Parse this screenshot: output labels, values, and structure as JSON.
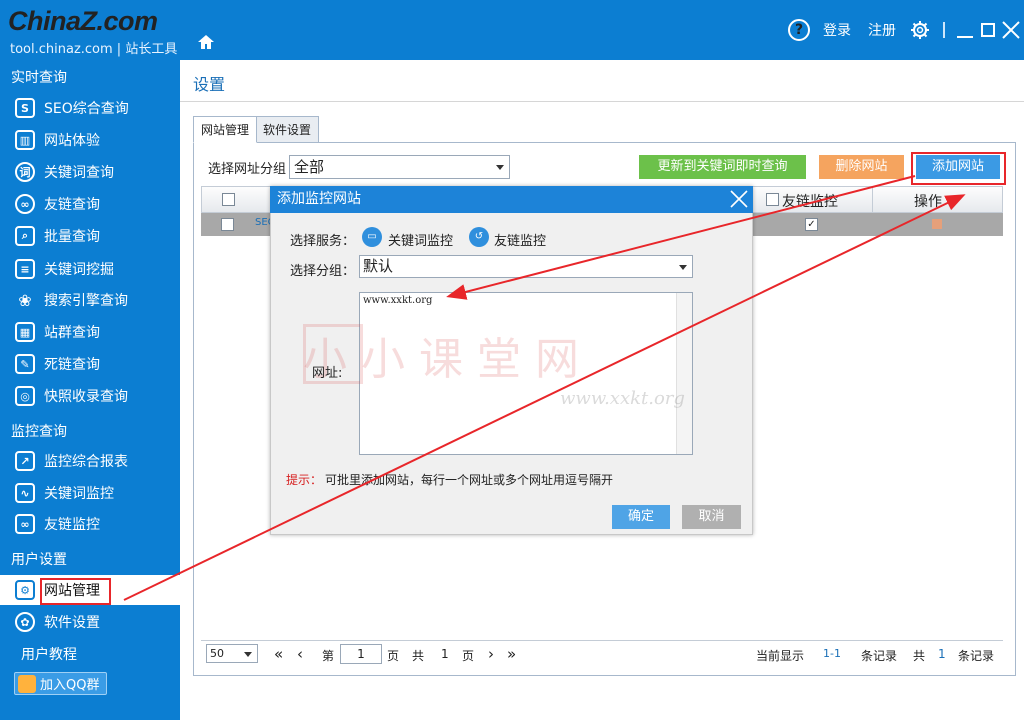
{
  "app": {
    "logo_text": "ChinaZ.com",
    "logo_sub": "tool.chinaz.com | 站长工具",
    "login": "登录",
    "register": "注册",
    "help_symbol": "?"
  },
  "sidebar": {
    "sections": [
      {
        "label": "实时查询"
      },
      {
        "label": "监控查询"
      },
      {
        "label": "用户设置"
      }
    ],
    "items": [
      {
        "label": "SEO综合查询",
        "icon": "magnifier-doc-icon"
      },
      {
        "label": "网站体验",
        "icon": "bar-chart-icon"
      },
      {
        "label": "关键词查询",
        "icon": "keyword-icon"
      },
      {
        "label": "友链查询",
        "icon": "link-icon"
      },
      {
        "label": "批量查询",
        "icon": "batch-search-icon"
      },
      {
        "label": "关键词挖掘",
        "icon": "list-icon"
      },
      {
        "label": "搜索引擎查询",
        "icon": "paw-icon"
      },
      {
        "label": "站群查询",
        "icon": "calendar-chart-icon"
      },
      {
        "label": "死链查询",
        "icon": "edit-icon"
      },
      {
        "label": "快照收录查询",
        "icon": "camera-icon"
      },
      {
        "label": "监控综合报表",
        "icon": "trend-chart-icon"
      },
      {
        "label": "关键词监控",
        "icon": "wave-chart-icon"
      },
      {
        "label": "友链监控",
        "icon": "link-monitor-icon"
      },
      {
        "label": "网站管理",
        "icon": "user-gear-icon"
      },
      {
        "label": "软件设置",
        "icon": "gear-icon"
      }
    ],
    "tutorial": "用户教程",
    "qq_group": "加入QQ群"
  },
  "page": {
    "title": "设置",
    "tabs": [
      {
        "label": "网站管理",
        "active": true
      },
      {
        "label": "软件设置",
        "active": false
      }
    ],
    "group_label": "选择网址分组",
    "group_value": "全部",
    "btn_update": "更新到关键词即时查询",
    "btn_delete": "删除网站",
    "btn_add": "添加网站",
    "col_friendlink": "友链监控",
    "col_ops": "操作",
    "row_site_prefix": "SEO"
  },
  "pager": {
    "page_size": "50",
    "page_word": "第",
    "page_num": "1",
    "page_unit": "页",
    "total_word": "共",
    "total_pages": "1",
    "total_unit": "页",
    "showing_label": "当前显示",
    "showing_range": "1-1",
    "records_label": "条记录",
    "total_label": "共",
    "total_records": "1",
    "total_records_label": "条记录"
  },
  "dialog": {
    "title": "添加监控网站",
    "service_label": "选择服务：",
    "service_keyword": "关键词监控",
    "service_link": "友链监控",
    "group_label": "选择分组：",
    "group_value": "默认",
    "url_label": "网址:",
    "url_value": "www.xxkt.org",
    "tip_label": "提示：",
    "tip_text": "可批里添加网站，每行一个网址或多个网址用逗号隔开",
    "ok": "确定",
    "cancel": "取消"
  },
  "watermark": {
    "text": "小小课堂网",
    "url": "www.xxkt.org"
  },
  "colors": {
    "brand_blue": "#0c7ed2",
    "annotation_red": "#e8262a",
    "btn_green": "#6cc14a",
    "btn_orange": "#f5a45f",
    "btn_blue": "#3b9ae4"
  }
}
